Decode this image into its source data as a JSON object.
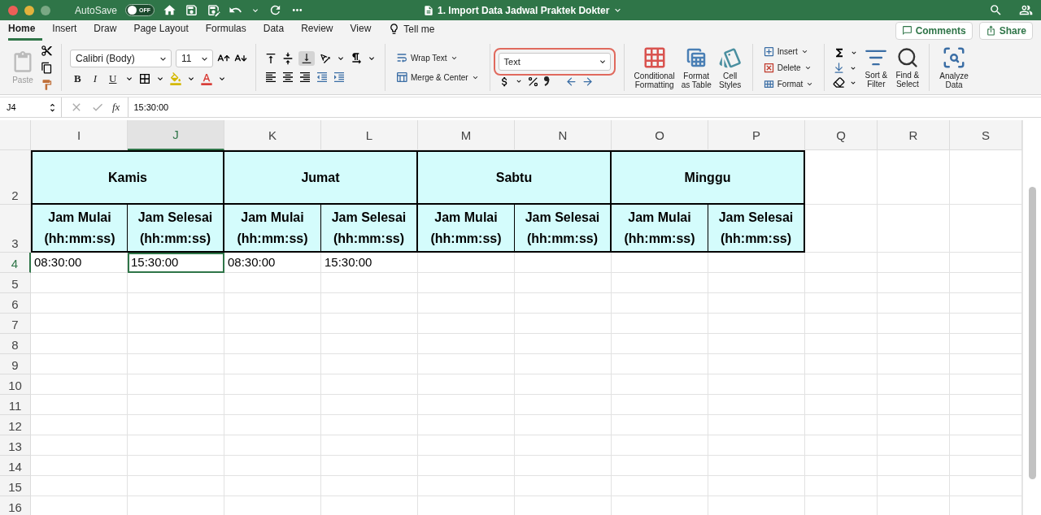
{
  "title_bar": {
    "autosave_label": "AutoSave",
    "autosave": {
      "on": false,
      "label": "OFF"
    },
    "document_title": "1. Import Data Jadwal Praktek Dokter"
  },
  "menu_tabs": [
    {
      "label": "Home",
      "selected": true
    },
    {
      "label": "Insert",
      "selected": false
    },
    {
      "label": "Draw",
      "selected": false
    },
    {
      "label": "Page Layout",
      "selected": false
    },
    {
      "label": "Formulas",
      "selected": false
    },
    {
      "label": "Data",
      "selected": false
    },
    {
      "label": "Review",
      "selected": false
    },
    {
      "label": "View",
      "selected": false
    }
  ],
  "tell_me": "Tell me",
  "header_buttons": [
    {
      "kind": "comments",
      "label": "Comments"
    },
    {
      "kind": "share",
      "label": "Share"
    }
  ],
  "ribbon": {
    "paste": "Paste",
    "font_name": "Calibri (Body)",
    "font_size": "11",
    "style_buttons": [
      "B",
      "I",
      "U"
    ],
    "wrap_text": "Wrap Text",
    "merge_center": "Merge & Center",
    "number_format": {
      "value": "Text",
      "highlighted": true
    },
    "style_commands": [
      {
        "kind": "conditional",
        "lines": [
          "Conditional",
          "Formatting"
        ]
      },
      {
        "kind": "table",
        "lines": [
          "Format",
          "as Table"
        ]
      },
      {
        "kind": "styles",
        "lines": [
          "Cell",
          "Styles"
        ]
      }
    ],
    "cell_commands": [
      {
        "kind": "insert",
        "label": "Insert"
      },
      {
        "kind": "delete",
        "label": "Delete"
      },
      {
        "kind": "format",
        "label": "Format"
      }
    ],
    "edit_commands": [
      {
        "kind": "sort",
        "lines": [
          "Sort &",
          "Filter"
        ]
      },
      {
        "kind": "find",
        "lines": [
          "Find &",
          "Select"
        ]
      }
    ],
    "analyze": {
      "lines": [
        "Analyze",
        "Data"
      ]
    }
  },
  "formula_bar": {
    "name_box": "J4",
    "function_label": "fx",
    "formula": "15:30:00"
  },
  "sheet": {
    "columns": [
      {
        "label": "I",
        "selected": false
      },
      {
        "label": "J",
        "selected": true
      },
      {
        "label": "K",
        "selected": false
      },
      {
        "label": "L",
        "selected": false
      },
      {
        "label": "M",
        "selected": false
      },
      {
        "label": "N",
        "selected": false
      },
      {
        "label": "O",
        "selected": false
      },
      {
        "label": "P",
        "selected": false
      },
      {
        "label": "Q",
        "selected": false
      },
      {
        "label": "R",
        "selected": false
      },
      {
        "label": "S",
        "selected": false
      }
    ],
    "day_row": {
      "label": "2",
      "days": [
        "Kamis",
        "Jumat",
        "Sabtu",
        "Minggu"
      ]
    },
    "sub_row": {
      "label": "3",
      "headers": [
        "Jam Mulai\n(hh:mm:ss)",
        "Jam Selesai\n(hh:mm:ss)",
        "Jam Mulai\n(hh:mm:ss)",
        "Jam Selesai\n(hh:mm:ss)",
        "Jam Mulai\n(hh:mm:ss)",
        "Jam Selesai\n(hh:mm:ss)",
        "Jam Mulai\n(hh:mm:ss)",
        "Jam Selesai\n(hh:mm:ss)"
      ]
    },
    "rows": [
      {
        "label": "4",
        "selected": true,
        "cells": [
          {
            "value": "08:30:00",
            "selected": false
          },
          {
            "value": "15:30:00",
            "selected": true
          },
          {
            "value": "08:30:00",
            "selected": false
          },
          {
            "value": "15:30:00",
            "selected": false
          }
        ]
      },
      {
        "label": "5",
        "selected": false
      },
      {
        "label": "6",
        "selected": false
      },
      {
        "label": "7",
        "selected": false
      },
      {
        "label": "8",
        "selected": false
      },
      {
        "label": "9",
        "selected": false
      },
      {
        "label": "10",
        "selected": false
      },
      {
        "label": "11",
        "selected": false
      },
      {
        "label": "12",
        "selected": false
      },
      {
        "label": "13",
        "selected": false
      },
      {
        "label": "14",
        "selected": false
      },
      {
        "label": "15",
        "selected": false
      },
      {
        "label": "16",
        "selected": false
      }
    ]
  }
}
